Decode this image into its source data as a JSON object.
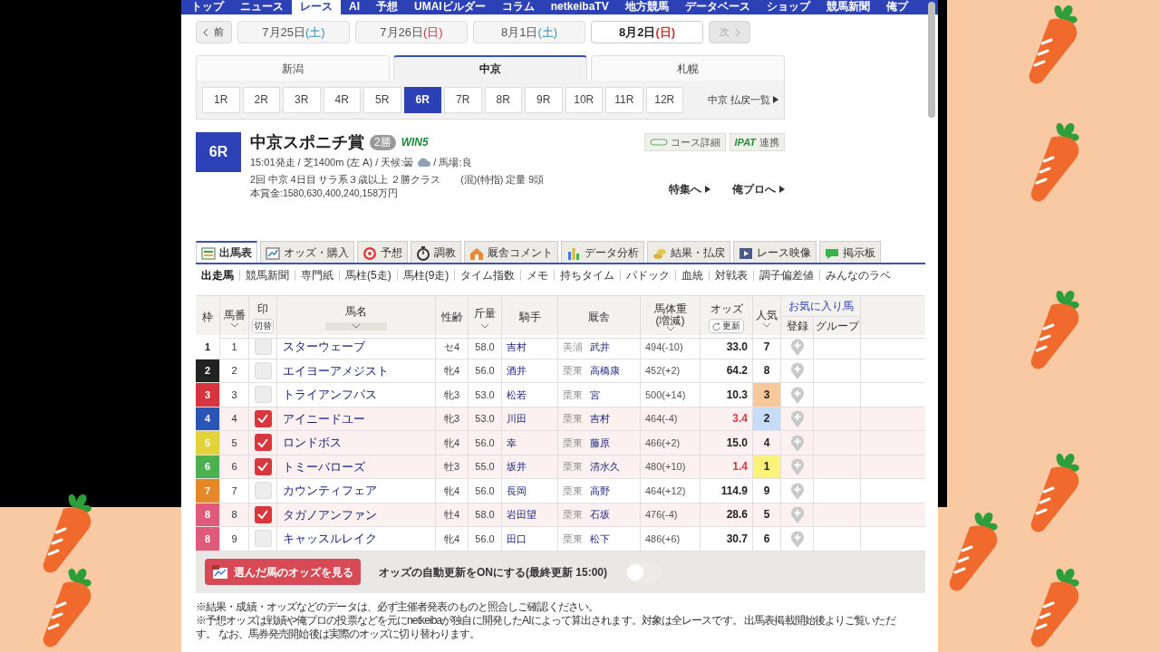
{
  "nav": [
    {
      "label": "トップ",
      "selected": false
    },
    {
      "label": "ニュース",
      "selected": false
    },
    {
      "label": "レース",
      "selected": true
    },
    {
      "label": "AI",
      "selected": false
    },
    {
      "label": "予想",
      "selected": false
    },
    {
      "label": "UMAIビルダー",
      "selected": false
    },
    {
      "label": "コラム",
      "selected": false
    },
    {
      "label": "netkeibaTV",
      "selected": false
    },
    {
      "label": "地方競馬",
      "selected": false
    },
    {
      "label": "データベース",
      "selected": false
    },
    {
      "label": "ショップ",
      "selected": false
    },
    {
      "label": "競馬新聞",
      "selected": false
    },
    {
      "label": "俺プ",
      "selected": false
    }
  ],
  "date_nav": {
    "prev": "前",
    "next": "次",
    "next_disabled": true,
    "dates": [
      {
        "date": "7月25日",
        "weekday": "(土)",
        "color": "#3b8fb5",
        "selected": false
      },
      {
        "date": "7月26日",
        "weekday": "(日)",
        "color": "#cc3333",
        "selected": false
      },
      {
        "date": "8月1日",
        "weekday": "(土)",
        "color": "#3b8fb5",
        "selected": false
      },
      {
        "date": "8月2日",
        "weekday": "(日)",
        "color": "#cc3333",
        "selected": true
      }
    ]
  },
  "venues": [
    {
      "label": "新潟",
      "selected": false
    },
    {
      "label": "中京",
      "selected": true
    },
    {
      "label": "札幌",
      "selected": false
    }
  ],
  "races": [
    {
      "label": "1R",
      "selected": false
    },
    {
      "label": "2R",
      "selected": false
    },
    {
      "label": "3R",
      "selected": false
    },
    {
      "label": "4R",
      "selected": false
    },
    {
      "label": "5R",
      "selected": false
    },
    {
      "label": "6R",
      "selected": true
    },
    {
      "label": "7R",
      "selected": false
    },
    {
      "label": "8R",
      "selected": false
    },
    {
      "label": "9R",
      "selected": false
    },
    {
      "label": "10R",
      "selected": false
    },
    {
      "label": "11R",
      "selected": false
    },
    {
      "label": "12R",
      "selected": false
    }
  ],
  "payout_link": "中京 払戻一覧",
  "race": {
    "number": "6R",
    "title": "中京スポニチ賞",
    "grade": "2勝",
    "win5": "WIN5",
    "course_button": "コース詳細",
    "ipat_logo": "IPAT",
    "ipat_label": "連携",
    "conditions": "15:01発走 / 芝1400m (左 A) / 天候:曇",
    "track": "/ 馬場:良",
    "details": "2回 中京 4日目 サラ系３歳以上 ２勝クラス　　(混)(特指) 定量 9頭",
    "prize": "本賞金:1580,630,400,240,158万円",
    "links": [
      "特集へ",
      "俺プロへ"
    ]
  },
  "main_tabs": [
    {
      "label": "出馬表",
      "selected": true
    },
    {
      "label": "オッズ・購入",
      "selected": false
    },
    {
      "label": "予想",
      "selected": false
    },
    {
      "label": "調教",
      "selected": false
    },
    {
      "label": "厩舎コメント",
      "selected": false
    },
    {
      "label": "データ分析",
      "selected": false
    },
    {
      "label": "結果・払戻",
      "selected": false
    },
    {
      "label": "レース映像",
      "selected": false
    },
    {
      "label": "掲示板",
      "selected": false
    }
  ],
  "sub_tabs": [
    {
      "label": "出走馬",
      "selected": true
    },
    {
      "label": "競馬新聞",
      "selected": false
    },
    {
      "label": "専門紙",
      "selected": false
    },
    {
      "label": "馬柱(5走)",
      "selected": false
    },
    {
      "label": "馬柱(9走)",
      "selected": false
    },
    {
      "label": "タイム指数",
      "selected": false
    },
    {
      "label": "メモ",
      "selected": false
    },
    {
      "label": "持ちタイム",
      "selected": false
    },
    {
      "label": "パドック",
      "selected": false
    },
    {
      "label": "血統",
      "selected": false
    },
    {
      "label": "対戦表",
      "selected": false
    },
    {
      "label": "調子偏差値",
      "selected": false
    },
    {
      "label": "みんなのラベ",
      "selected": false
    }
  ],
  "table": {
    "columns": {
      "frame": "枠",
      "number": "馬番",
      "mark": "印",
      "mark_toggle": "切替",
      "name": "馬名",
      "sex_age": "性齢",
      "weight": "斤量",
      "jockey": "騎手",
      "stable": "厩舎",
      "body_weight": "馬体重",
      "body_weight_sub": "(増減)",
      "odds": "オッズ",
      "odds_refresh": "更新",
      "popularity": "人気",
      "favorites": "お気に入り馬",
      "register": "登録",
      "group": "グループ"
    },
    "rows": [
      {
        "frame": "1",
        "color": "#ffffff",
        "number": "1",
        "checked": false,
        "name": "スターウェーブ",
        "sex_age": "セ4",
        "weight": "58.0",
        "jockey": "吉村",
        "region": "美浦",
        "trainer": "武井",
        "body_weight": "494(-10)",
        "odds": "33.0",
        "odds_highlight": false,
        "popularity": {
          "rank": "7"
        }
      },
      {
        "frame": "2",
        "color": "#222222",
        "number": "2",
        "checked": false,
        "name": "エイヨーアメジスト",
        "sex_age": "牝4",
        "weight": "56.0",
        "jockey": "酒井",
        "region": "栗東",
        "trainer": "高橋康",
        "body_weight": "452(+2)",
        "odds": "64.2",
        "odds_highlight": false,
        "popularity": {
          "rank": "8"
        }
      },
      {
        "frame": "3",
        "color": "#d6353f",
        "number": "3",
        "checked": false,
        "name": "トライアンフパス",
        "sex_age": "牝3",
        "weight": "53.0",
        "jockey": "松若",
        "region": "栗東",
        "trainer": "宮",
        "body_weight": "500(+14)",
        "odds": "10.3",
        "odds_highlight": false,
        "popularity": {
          "rank": "3",
          "color": "#f6c89a"
        }
      },
      {
        "frame": "4",
        "color": "#2a55b5",
        "number": "4",
        "checked": true,
        "name": "アイニードユー",
        "sex_age": "牝3",
        "weight": "53.0",
        "jockey": "川田",
        "region": "栗東",
        "trainer": "吉村",
        "body_weight": "464(-4)",
        "odds": "3.4",
        "odds_highlight": true,
        "popularity": {
          "rank": "2",
          "color": "#c7ddf7"
        }
      },
      {
        "frame": "5",
        "color": "#e3d23a",
        "number": "5",
        "checked": true,
        "name": "ロンドボス",
        "sex_age": "牝4",
        "weight": "56.0",
        "jockey": "幸",
        "region": "栗東",
        "trainer": "藤原",
        "body_weight": "466(+2)",
        "odds": "15.0",
        "odds_highlight": false,
        "popularity": {
          "rank": "4"
        }
      },
      {
        "frame": "6",
        "color": "#4caf50",
        "number": "6",
        "checked": true,
        "name": "トミーバローズ",
        "sex_age": "牡3",
        "weight": "55.0",
        "jockey": "坂井",
        "region": "栗東",
        "trainer": "清水久",
        "body_weight": "480(+10)",
        "odds": "1.4",
        "odds_highlight": true,
        "popularity": {
          "rank": "1",
          "color": "#fbf27a"
        }
      },
      {
        "frame": "7",
        "color": "#e4892a",
        "number": "7",
        "checked": false,
        "name": "カウンティフェア",
        "sex_age": "牝4",
        "weight": "56.0",
        "jockey": "長岡",
        "region": "栗東",
        "trainer": "高野",
        "body_weight": "464(+12)",
        "odds": "114.9",
        "odds_highlight": false,
        "popularity": {
          "rank": "9"
        }
      },
      {
        "frame": "8",
        "color": "#de5b7b",
        "number": "8",
        "checked": true,
        "name": "タガノアンファン",
        "sex_age": "牡4",
        "weight": "58.0",
        "jockey": "岩田望",
        "region": "栗東",
        "trainer": "石坂",
        "body_weight": "476(-4)",
        "odds": "28.6",
        "odds_highlight": false,
        "popularity": {
          "rank": "5"
        }
      },
      {
        "frame": "8",
        "color": "#de5b7b",
        "number": "9",
        "checked": false,
        "name": "キャッスルレイク",
        "sex_age": "牝4",
        "weight": "56.0",
        "jockey": "田口",
        "region": "栗東",
        "trainer": "松下",
        "body_weight": "486(+6)",
        "odds": "30.7",
        "odds_highlight": false,
        "popularity": {
          "rank": "6"
        }
      }
    ]
  },
  "odds_bar": {
    "button": "選んだ馬のオッズを見る",
    "auto_update": "オッズの自動更新をONにする(最終更新 15:00)",
    "on": false
  },
  "notes": [
    "※結果・成績・オッズなどのデータは、必ず主催者発表のものと照合しご確認ください。",
    "※予想オッズは戦績や俺プロの投票などを元にnetkeibaが独自に開発したAIによって算出されます。対象は全レースです。 出馬表掲載開始後よりご覧いただ",
    "す。 なお、馬券発売開始後は実際のオッズに切り替わります。"
  ]
}
